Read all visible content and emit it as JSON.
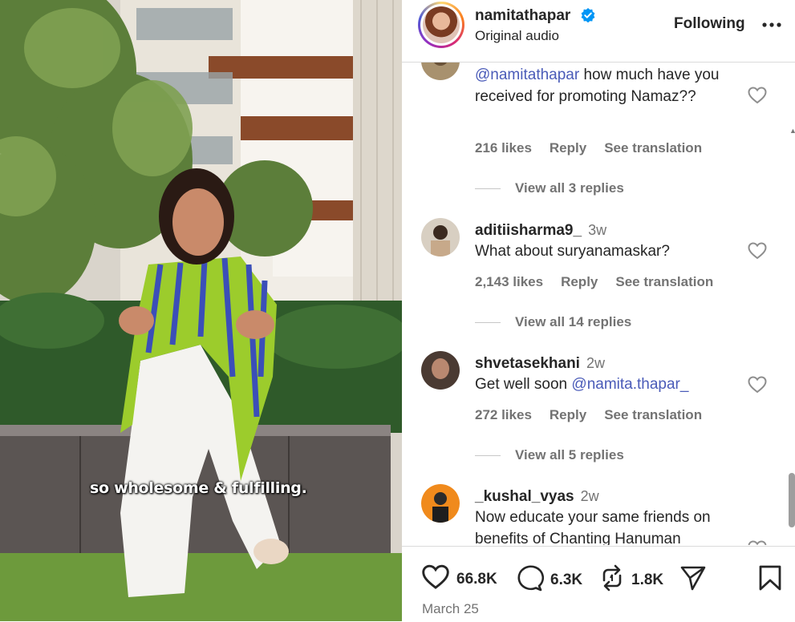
{
  "header": {
    "username": "namitathapar",
    "subtitle": "Original audio",
    "follow_label": "Following"
  },
  "video": {
    "caption": "so wholesome & fulfilling."
  },
  "comments": [
    {
      "username": "",
      "time": "",
      "text_parts": [
        "@namitathapar",
        " how much have you received for promoting Namaz??"
      ],
      "likes": "216 likes",
      "reply": "Reply",
      "translate": "See translation",
      "replies": "View all 3 replies"
    },
    {
      "username": "aditiisharma9_",
      "time": "3w",
      "text": "What about suryanamaskar?",
      "likes": "2,143 likes",
      "reply": "Reply",
      "translate": "See translation",
      "replies": "View all 14 replies"
    },
    {
      "username": "shvetasekhani",
      "time": "2w",
      "text": "Get well soon ",
      "mention": "@namita.thapar_",
      "likes": "272 likes",
      "reply": "Reply",
      "translate": "See translation",
      "replies": "View all 5 replies"
    },
    {
      "username": "_kushal_vyas",
      "time": "2w",
      "text": "Now educate your same friends on benefits of Chanting Hanuman"
    }
  ],
  "actions": {
    "likes": "66.8K",
    "comments": "6.3K",
    "reposts": "1.8K",
    "date": "March 25"
  },
  "icons": {
    "verified": "verified-badge-icon",
    "more": "more-options-icon",
    "heart": "heart-icon",
    "comment": "comment-icon",
    "repost": "repost-icon",
    "share": "share-icon",
    "save": "bookmark-icon"
  },
  "colors": {
    "verified_blue": "#0095f6",
    "mention": "#4a5bb8",
    "muted_text": "#737373"
  }
}
